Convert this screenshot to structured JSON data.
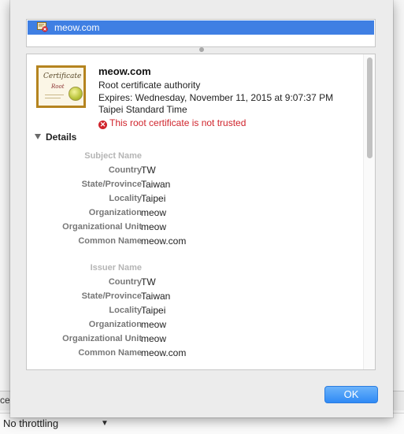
{
  "background": {
    "strip_text": "ces",
    "throttle_label": "No throttling",
    "throttle_arrow": "▼"
  },
  "cert_list": {
    "selected_item": "meow.com",
    "selected_icon": "certificate-untrusted-icon"
  },
  "certificate": {
    "image_title": "Certificate",
    "image_sub": "Root",
    "name": "meow.com",
    "type": "Root certificate authority",
    "expires": "Expires: Wednesday, November 11, 2015 at 9:07:37 PM",
    "timezone": "Taipei Standard Time",
    "warning_icon": "✕",
    "warning": "This root certificate is not trusted"
  },
  "details": {
    "toggle_label": "Details",
    "subject": {
      "heading": "Subject Name",
      "fields": [
        {
          "label": "Country",
          "value": "TW"
        },
        {
          "label": "State/Province",
          "value": "Taiwan"
        },
        {
          "label": "Locality",
          "value": "Taipei"
        },
        {
          "label": "Organization",
          "value": "meow"
        },
        {
          "label": "Organizational Unit",
          "value": "meow"
        },
        {
          "label": "Common Name",
          "value": "meow.com"
        }
      ]
    },
    "issuer": {
      "heading": "Issuer Name",
      "fields": [
        {
          "label": "Country",
          "value": "TW"
        },
        {
          "label": "State/Province",
          "value": "Taiwan"
        },
        {
          "label": "Locality",
          "value": "Taipei"
        },
        {
          "label": "Organization",
          "value": "meow"
        },
        {
          "label": "Organizational Unit",
          "value": "meow"
        },
        {
          "label": "Common Name",
          "value": "meow.com"
        }
      ]
    }
  },
  "buttons": {
    "ok": "OK"
  },
  "colors": {
    "selection": "#3f7fe3",
    "warning": "#d0242c",
    "ok_button": "#2f8af5"
  }
}
